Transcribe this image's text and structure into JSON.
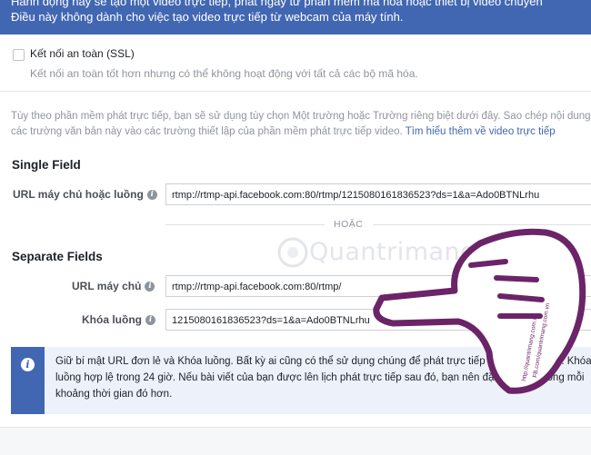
{
  "banner": {
    "line1": "Hành động này sẽ tạo một video trực tiếp, phát ngay từ phần mềm mã hóa hoặc thiết bị video chuyên",
    "line2": "Điều này không dành cho việc tạo video trực tiếp từ webcam của máy tính."
  },
  "ssl": {
    "label": "Kết nối an toàn (SSL)",
    "description": "Kết nối an toàn tốt hơn nhưng có thể không hoạt động với tất cả các bộ mã hóa."
  },
  "description": {
    "text": "Tùy theo phần mềm phát trực tiếp, bạn sẽ sử dụng tùy chọn Một trường hoặc Trường riêng biệt dưới đây. Sao chép nội dung các trường văn bản này vào các trường thiết lập của phần mềm phát trực tiếp video.",
    "link": "Tìm hiểu thêm về video trực tiếp"
  },
  "single_field": {
    "heading": "Single Field",
    "label": "URL máy chủ hoặc luồng",
    "value": "rtmp://rtmp-api.facebook.com:80/rtmp/1215080161836523?ds=1&a=Ado0BTNLrhu"
  },
  "divider": {
    "text": "HOẶC"
  },
  "separate_fields": {
    "heading": "Separate Fields",
    "server_label": "URL máy chủ",
    "server_value": "rtmp://rtmp-api.facebook.com:80/rtmp/",
    "key_label": "Khóa luồng",
    "key_value": "1215080161836523?ds=1&a=Ado0BTNLrhu"
  },
  "notice": {
    "text": "Giữ bí mật URL đơn lẻ và Khóa luồng. Bất kỳ ai cũng có thể sử dụng chúng để phát trực tiếp bài viết của bạn. Khóa luồng hợp lệ trong 24 giờ. Nếu bài viết của bạn được lên lịch phát trực tiếp sau đó, bạn nên đặt lại khóa luồng mỗi khoảng thời gian đó hơn."
  },
  "watermark": {
    "brand": "Quantrimang",
    "url1": "http://quantrimang.com.vn",
    "url2": "FB.com/quantrimang.com.vn"
  },
  "colors": {
    "brand_blue": "#4267b2",
    "notice_bg": "#edf2fa",
    "hand_stroke": "#6b2468"
  }
}
